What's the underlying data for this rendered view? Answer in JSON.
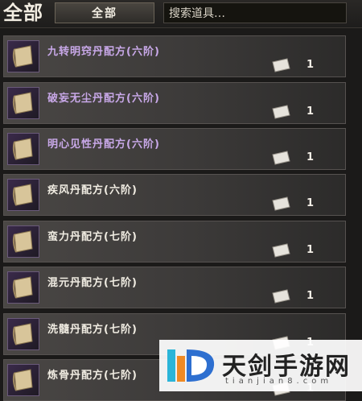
{
  "header": {
    "category_title": "全部",
    "filter_label": "全部",
    "search_placeholder": "搜索道具…"
  },
  "items": [
    {
      "name": "九转明窍丹配方(六阶)",
      "count": "1",
      "highlight": true
    },
    {
      "name": "破妄无尘丹配方(六阶)",
      "count": "1",
      "highlight": true
    },
    {
      "name": "明心见性丹配方(六阶)",
      "count": "1",
      "highlight": true
    },
    {
      "name": "疾风丹配方(六阶)",
      "count": "1",
      "highlight": false
    },
    {
      "name": "蛮力丹配方(七阶)",
      "count": "1",
      "highlight": false
    },
    {
      "name": "混元丹配方(七阶)",
      "count": "1",
      "highlight": false
    },
    {
      "name": "洗髓丹配方(七阶)",
      "count": "1",
      "highlight": false
    },
    {
      "name": "炼骨丹配方(七阶)",
      "count": "1",
      "highlight": false
    }
  ],
  "watermark": {
    "title": "天剑手游网",
    "url": "tianjian8.com"
  },
  "colors": {
    "rare_name": "#c8a8e8",
    "normal_name": "#f0ece2"
  }
}
